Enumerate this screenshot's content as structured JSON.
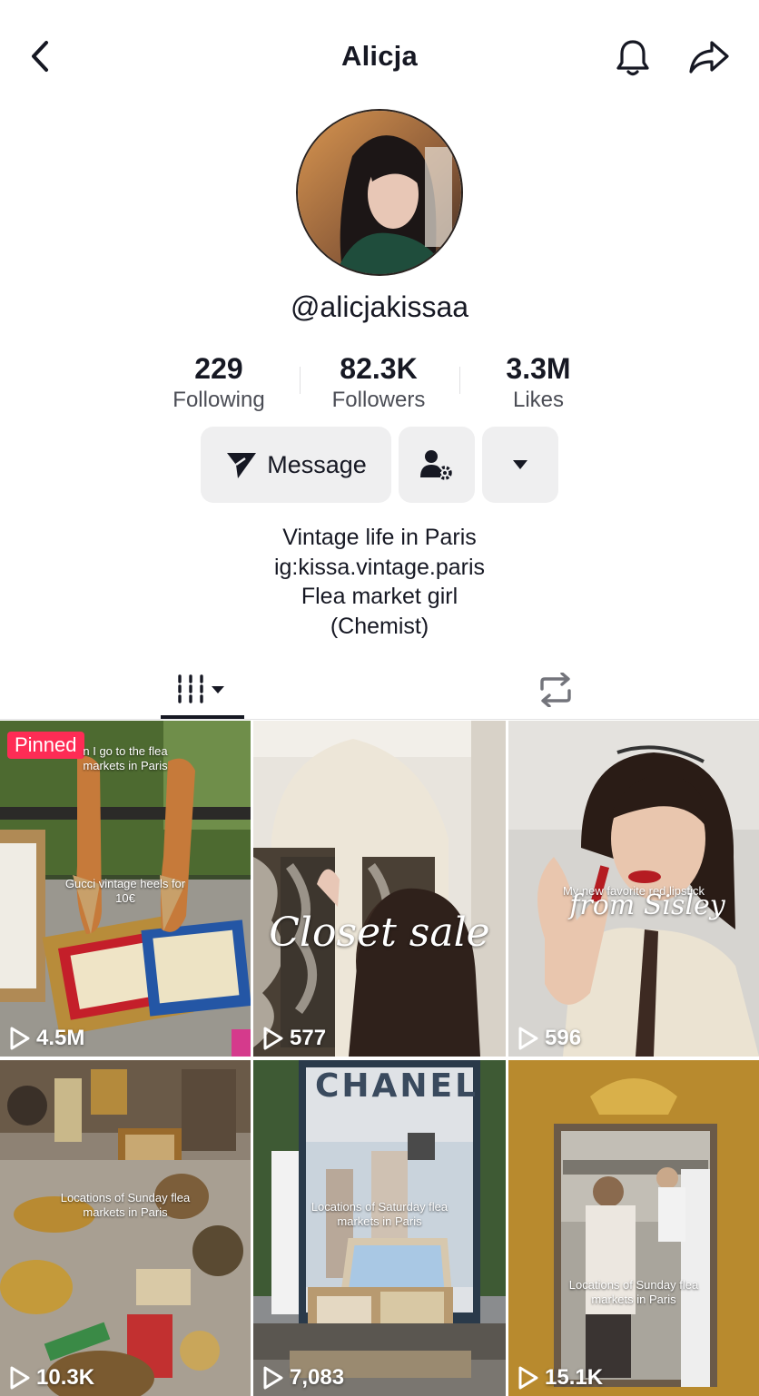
{
  "header": {
    "title": "Alicja",
    "back_icon": "chevron-left-icon",
    "bell_icon": "bell-icon",
    "share_icon": "share-icon"
  },
  "profile": {
    "handle": "@alicjakissaa",
    "stats": [
      {
        "value": "229",
        "label": "Following"
      },
      {
        "value": "82.3K",
        "label": "Followers"
      },
      {
        "value": "3.3M",
        "label": "Likes"
      }
    ],
    "message_label": "Message",
    "bio": [
      "Vintage life in Paris",
      "ig:kissa.vintage.paris",
      "Flea market girl",
      "(Chemist)"
    ]
  },
  "tabs": {
    "videos_icon": "videos-grid-icon",
    "reposts_icon": "repost-icon"
  },
  "videos": [
    {
      "views": "4.5M",
      "pinned_label": "Pinned",
      "caption_top": "n I go to the flea markets in Paris",
      "caption_mid": "Gucci vintage heels for 10€"
    },
    {
      "views": "577",
      "caption_script": "Closet sale"
    },
    {
      "views": "596",
      "caption_top": "My new favorite red lipstick",
      "caption_script": "from Sisley"
    },
    {
      "views": "10.3K",
      "caption_mid": "Locations of Sunday flea markets in Paris"
    },
    {
      "views": "7,083",
      "brand": "CHANEL",
      "caption_mid": "Locations of Saturday flea markets in Paris"
    },
    {
      "views": "15.1K",
      "caption_mid": "Locations of Sunday flea markets in Paris"
    }
  ],
  "colors": {
    "text": "#161823",
    "pinned": "#fe2c55",
    "button_bg": "#efeff0"
  }
}
